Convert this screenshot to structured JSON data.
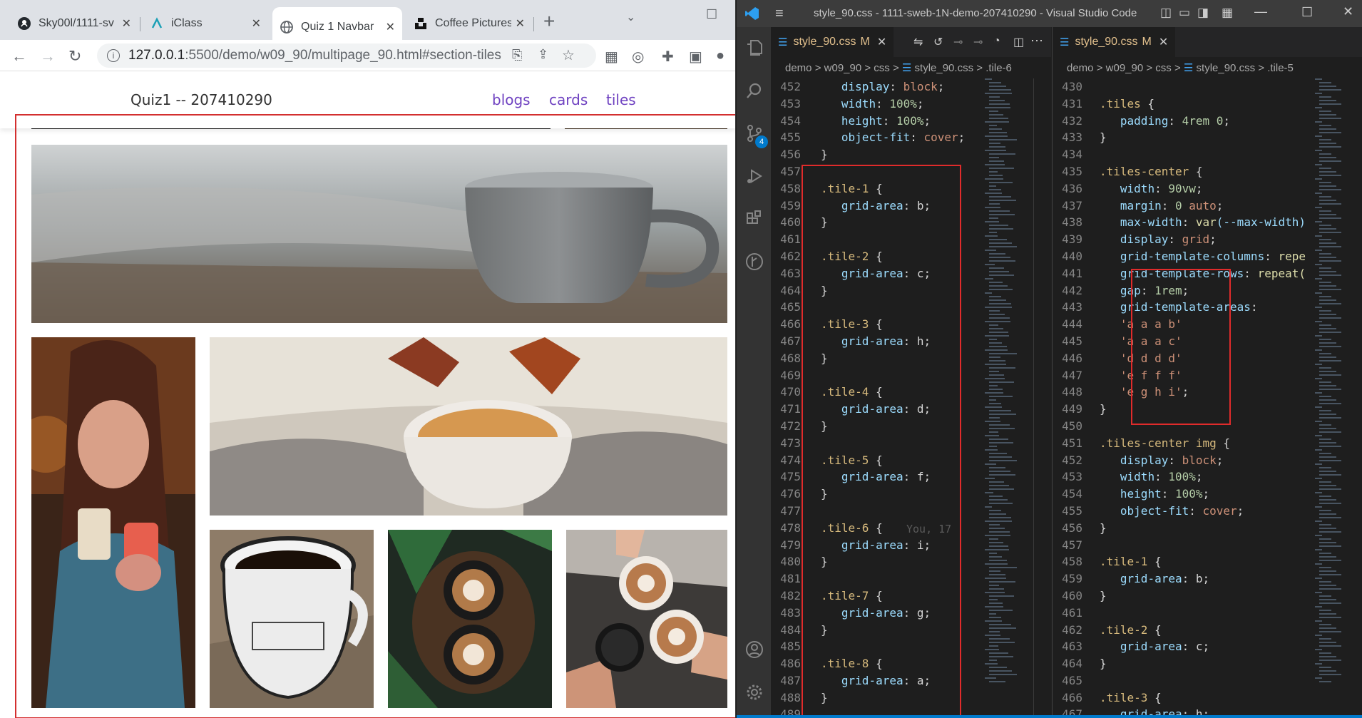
{
  "browser": {
    "tabs": [
      {
        "title": "Sky00l/1111-sv",
        "icon": "github-icon"
      },
      {
        "title": "iClass",
        "icon": "iclass-icon"
      },
      {
        "title": "Quiz 1 Navbar",
        "icon": "globe-icon",
        "active": true
      },
      {
        "title": "Coffee Pictures",
        "icon": "unsplash-icon"
      }
    ],
    "new_tab": "+",
    "url": {
      "host": "127.0.0.1",
      "path": ":5500/demo/w09_90/multipage_90.html#section-tiles"
    }
  },
  "site": {
    "brand": "Quiz1 -- 207410290",
    "links": [
      "blogs",
      "cards",
      "tiles"
    ]
  },
  "vscode": {
    "title": "style_90.css - 1111-sweb-1N-demo-207410290 - Visual Studio Code",
    "scm_badge": "4",
    "left": {
      "tab": "style_90.css",
      "modified": "M",
      "crumbs": [
        "demo",
        "w09_90",
        "css",
        "style_90.css",
        ".tile-6"
      ],
      "blame": "You, 17",
      "lines": [
        {
          "n": "452",
          "t": [
            [
              "   ",
              "pun"
            ],
            [
              "display",
              "prop"
            ],
            [
              ": ",
              "pun"
            ],
            [
              "block",
              "val"
            ],
            [
              ";",
              "pun"
            ]
          ]
        },
        {
          "n": "453",
          "t": [
            [
              "   ",
              "pun"
            ],
            [
              "width",
              "prop"
            ],
            [
              ": ",
              "pun"
            ],
            [
              "100%",
              "numv"
            ],
            [
              ";",
              "pun"
            ]
          ]
        },
        {
          "n": "454",
          "t": [
            [
              "   ",
              "pun"
            ],
            [
              "height",
              "prop"
            ],
            [
              ": ",
              "pun"
            ],
            [
              "100%",
              "numv"
            ],
            [
              ";",
              "pun"
            ]
          ]
        },
        {
          "n": "455",
          "t": [
            [
              "   ",
              "pun"
            ],
            [
              "object-fit",
              "prop"
            ],
            [
              ": ",
              "pun"
            ],
            [
              "cover",
              "val"
            ],
            [
              ";",
              "pun"
            ]
          ]
        },
        {
          "n": "456",
          "t": [
            [
              "}",
              "pun"
            ]
          ]
        },
        {
          "n": "457",
          "t": []
        },
        {
          "n": "458",
          "t": [
            [
              ".tile-1",
              "sel"
            ],
            [
              " {",
              "pun"
            ]
          ]
        },
        {
          "n": "459",
          "t": [
            [
              "   ",
              "pun"
            ],
            [
              "grid-area",
              "prop"
            ],
            [
              ": b;",
              "pun"
            ]
          ]
        },
        {
          "n": "460",
          "t": [
            [
              "}",
              "pun"
            ]
          ]
        },
        {
          "n": "461",
          "t": []
        },
        {
          "n": "462",
          "t": [
            [
              ".tile-2",
              "sel"
            ],
            [
              " {",
              "pun"
            ]
          ]
        },
        {
          "n": "463",
          "t": [
            [
              "   ",
              "pun"
            ],
            [
              "grid-area",
              "prop"
            ],
            [
              ": c;",
              "pun"
            ]
          ]
        },
        {
          "n": "464",
          "t": [
            [
              "}",
              "pun"
            ]
          ]
        },
        {
          "n": "465",
          "t": []
        },
        {
          "n": "466",
          "t": [
            [
              ".tile-3",
              "sel"
            ],
            [
              " {",
              "pun"
            ]
          ]
        },
        {
          "n": "467",
          "t": [
            [
              "   ",
              "pun"
            ],
            [
              "grid-area",
              "prop"
            ],
            [
              ": h;",
              "pun"
            ]
          ]
        },
        {
          "n": "468",
          "t": [
            [
              "}",
              "pun"
            ]
          ]
        },
        {
          "n": "469",
          "t": []
        },
        {
          "n": "470",
          "t": [
            [
              ".tile-4",
              "sel"
            ],
            [
              " {",
              "pun"
            ]
          ]
        },
        {
          "n": "471",
          "t": [
            [
              "   ",
              "pun"
            ],
            [
              "grid-area",
              "prop"
            ],
            [
              ": d;",
              "pun"
            ]
          ]
        },
        {
          "n": "472",
          "t": [
            [
              "}",
              "pun"
            ]
          ]
        },
        {
          "n": "473",
          "t": []
        },
        {
          "n": "474",
          "t": [
            [
              ".tile-5",
              "sel"
            ],
            [
              " {",
              "pun"
            ]
          ]
        },
        {
          "n": "475",
          "t": [
            [
              "   ",
              "pun"
            ],
            [
              "grid-area",
              "prop"
            ],
            [
              ": f;",
              "pun"
            ]
          ]
        },
        {
          "n": "476",
          "t": [
            [
              "}",
              "pun"
            ]
          ]
        },
        {
          "n": "477",
          "t": []
        },
        {
          "n": "478",
          "t": [
            [
              ".tile-6",
              "sel"
            ],
            [
              " {",
              "pun"
            ]
          ]
        },
        {
          "n": "479",
          "t": [
            [
              "   ",
              "pun"
            ],
            [
              "grid-area",
              "prop"
            ],
            [
              ": i;",
              "pun"
            ]
          ]
        },
        {
          "n": "480",
          "t": [
            [
              "}",
              "pun"
            ]
          ]
        },
        {
          "n": "481",
          "t": []
        },
        {
          "n": "482",
          "t": [
            [
              ".tile-7",
              "sel"
            ],
            [
              " {",
              "pun"
            ]
          ]
        },
        {
          "n": "483",
          "t": [
            [
              "   ",
              "pun"
            ],
            [
              "grid-area",
              "prop"
            ],
            [
              ": g;",
              "pun"
            ]
          ]
        },
        {
          "n": "484",
          "t": [
            [
              "}",
              "pun"
            ]
          ]
        },
        {
          "n": "485",
          "t": []
        },
        {
          "n": "486",
          "t": [
            [
              ".tile-8",
              "sel"
            ],
            [
              " {",
              "pun"
            ]
          ]
        },
        {
          "n": "487",
          "t": [
            [
              "   ",
              "pun"
            ],
            [
              "grid-area",
              "prop"
            ],
            [
              ": a;",
              "pun"
            ]
          ]
        },
        {
          "n": "488",
          "t": [
            [
              "}",
              "pun"
            ]
          ]
        },
        {
          "n": "489",
          "t": []
        }
      ]
    },
    "right": {
      "tab": "style_90.css",
      "modified": "M",
      "crumbs": [
        "demo",
        "w09_90",
        "css",
        "style_90.css",
        ".tile-5"
      ],
      "lines": [
        {
          "n": "430",
          "t": []
        },
        {
          "n": "431",
          "t": [
            [
              ".tiles",
              "sel"
            ],
            [
              " {",
              "pun"
            ]
          ]
        },
        {
          "n": "432",
          "t": [
            [
              "   ",
              "pun"
            ],
            [
              "padding",
              "prop"
            ],
            [
              ": ",
              "pun"
            ],
            [
              "4rem 0",
              "numv"
            ],
            [
              ";",
              "pun"
            ]
          ]
        },
        {
          "n": "433",
          "t": [
            [
              "}",
              "pun"
            ]
          ]
        },
        {
          "n": "434",
          "t": []
        },
        {
          "n": "435",
          "t": [
            [
              ".tiles-center",
              "sel"
            ],
            [
              " {",
              "pun"
            ]
          ]
        },
        {
          "n": "436",
          "t": [
            [
              "   ",
              "pun"
            ],
            [
              "width",
              "prop"
            ],
            [
              ": ",
              "pun"
            ],
            [
              "90vw",
              "numv"
            ],
            [
              ";",
              "pun"
            ]
          ]
        },
        {
          "n": "437",
          "t": [
            [
              "   ",
              "pun"
            ],
            [
              "margin",
              "prop"
            ],
            [
              ": ",
              "pun"
            ],
            [
              "0 ",
              "numv"
            ],
            [
              "auto",
              "val"
            ],
            [
              ";",
              "pun"
            ]
          ]
        },
        {
          "n": "438",
          "t": [
            [
              "   ",
              "pun"
            ],
            [
              "max-width",
              "prop"
            ],
            [
              ": ",
              "pun"
            ],
            [
              "var",
              "fn"
            ],
            [
              "(--max-width)",
              "prop"
            ]
          ]
        },
        {
          "n": "439",
          "t": [
            [
              "   ",
              "pun"
            ],
            [
              "display",
              "prop"
            ],
            [
              ": ",
              "pun"
            ],
            [
              "grid",
              "val"
            ],
            [
              ";",
              "pun"
            ]
          ]
        },
        {
          "n": "440",
          "t": [
            [
              "   ",
              "pun"
            ],
            [
              "grid-template-columns",
              "prop"
            ],
            [
              ": ",
              "pun"
            ],
            [
              "repe",
              "fn"
            ]
          ]
        },
        {
          "n": "441",
          "t": [
            [
              "   ",
              "pun"
            ],
            [
              "grid-template-rows",
              "prop"
            ],
            [
              ": ",
              "pun"
            ],
            [
              "repeat(",
              "fn"
            ]
          ]
        },
        {
          "n": "442",
          "t": [
            [
              "   ",
              "pun"
            ],
            [
              "gap",
              "prop"
            ],
            [
              ": ",
              "pun"
            ],
            [
              "1rem",
              "numv"
            ],
            [
              ";",
              "pun"
            ]
          ]
        },
        {
          "n": "443",
          "t": [
            [
              "   ",
              "pun"
            ],
            [
              "grid-template-areas",
              "prop"
            ],
            [
              ":",
              "pun"
            ]
          ]
        },
        {
          "n": "444",
          "t": [
            [
              "   ",
              "pun"
            ],
            [
              "'a a a b'",
              "val"
            ]
          ]
        },
        {
          "n": "445",
          "t": [
            [
              "   ",
              "pun"
            ],
            [
              "'a a a c'",
              "val"
            ]
          ]
        },
        {
          "n": "446",
          "t": [
            [
              "   ",
              "pun"
            ],
            [
              "'d d d d'",
              "val"
            ]
          ]
        },
        {
          "n": "447",
          "t": [
            [
              "   ",
              "pun"
            ],
            [
              "'e f f f'",
              "val"
            ]
          ]
        },
        {
          "n": "448",
          "t": [
            [
              "   ",
              "pun"
            ],
            [
              "'e g h i'",
              "val"
            ],
            [
              ";",
              "pun"
            ]
          ]
        },
        {
          "n": "449",
          "t": [
            [
              "}",
              "pun"
            ]
          ]
        },
        {
          "n": "450",
          "t": []
        },
        {
          "n": "451",
          "t": [
            [
              ".tiles-center img",
              "sel"
            ],
            [
              " {",
              "pun"
            ]
          ]
        },
        {
          "n": "452",
          "t": [
            [
              "   ",
              "pun"
            ],
            [
              "display",
              "prop"
            ],
            [
              ": ",
              "pun"
            ],
            [
              "block",
              "val"
            ],
            [
              ";",
              "pun"
            ]
          ]
        },
        {
          "n": "453",
          "t": [
            [
              "   ",
              "pun"
            ],
            [
              "width",
              "prop"
            ],
            [
              ": ",
              "pun"
            ],
            [
              "100%",
              "numv"
            ],
            [
              ";",
              "pun"
            ]
          ]
        },
        {
          "n": "454",
          "t": [
            [
              "   ",
              "pun"
            ],
            [
              "height",
              "prop"
            ],
            [
              ": ",
              "pun"
            ],
            [
              "100%",
              "numv"
            ],
            [
              ";",
              "pun"
            ]
          ]
        },
        {
          "n": "455",
          "t": [
            [
              "   ",
              "pun"
            ],
            [
              "object-fit",
              "prop"
            ],
            [
              ": ",
              "pun"
            ],
            [
              "cover",
              "val"
            ],
            [
              ";",
              "pun"
            ]
          ]
        },
        {
          "n": "456",
          "t": [
            [
              "}",
              "pun"
            ]
          ]
        },
        {
          "n": "457",
          "t": []
        },
        {
          "n": "458",
          "t": [
            [
              ".tile-1",
              "sel"
            ],
            [
              " {",
              "pun"
            ]
          ]
        },
        {
          "n": "459",
          "t": [
            [
              "   ",
              "pun"
            ],
            [
              "grid-area",
              "prop"
            ],
            [
              ": b;",
              "pun"
            ]
          ]
        },
        {
          "n": "460",
          "t": [
            [
              "}",
              "pun"
            ]
          ]
        },
        {
          "n": "461",
          "t": []
        },
        {
          "n": "462",
          "t": [
            [
              ".tile-2",
              "sel"
            ],
            [
              " {",
              "pun"
            ]
          ]
        },
        {
          "n": "463",
          "t": [
            [
              "   ",
              "pun"
            ],
            [
              "grid-area",
              "prop"
            ],
            [
              ": c;",
              "pun"
            ]
          ]
        },
        {
          "n": "464",
          "t": [
            [
              "}",
              "pun"
            ]
          ]
        },
        {
          "n": "465",
          "t": []
        },
        {
          "n": "466",
          "t": [
            [
              ".tile-3",
              "sel"
            ],
            [
              " {",
              "pun"
            ]
          ]
        },
        {
          "n": "467",
          "t": [
            [
              "   ",
              "pun"
            ],
            [
              "grid-area",
              "prop"
            ],
            [
              ": h;",
              "pun"
            ]
          ]
        }
      ]
    }
  }
}
